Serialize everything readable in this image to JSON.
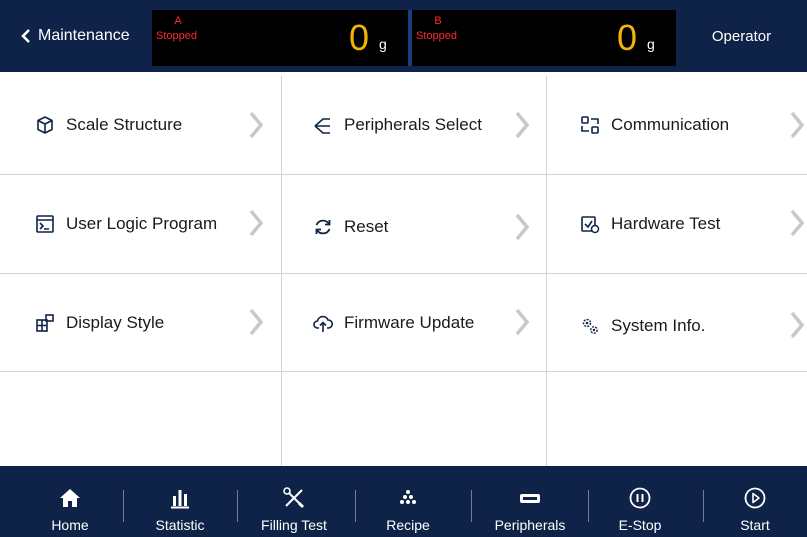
{
  "header": {
    "back_label": "Maintenance",
    "scale_a": {
      "letter": "A",
      "status": "Stopped",
      "value": "0",
      "unit": "g"
    },
    "scale_b": {
      "letter": "B",
      "status": "Stopped",
      "value": "0",
      "unit": "g"
    },
    "user_label": "Operator"
  },
  "menu": {
    "items": [
      {
        "label": "Scale Structure",
        "icon": "cube-icon"
      },
      {
        "label": "Peripherals Select",
        "icon": "branch-icon"
      },
      {
        "label": "Communication",
        "icon": "network-icon"
      },
      {
        "label": "User Logic Program",
        "icon": "terminal-icon"
      },
      {
        "label": "Reset",
        "icon": "refresh-icon"
      },
      {
        "label": "Hardware Test",
        "icon": "hardware-check-icon"
      },
      {
        "label": "Display Style",
        "icon": "layout-icon"
      },
      {
        "label": "Firmware Update",
        "icon": "cloud-upload-icon"
      },
      {
        "label": "System Info.",
        "icon": "gears-icon"
      }
    ]
  },
  "bottom_nav": {
    "items": [
      {
        "label": "Home",
        "icon": "home-icon"
      },
      {
        "label": "Statistic",
        "icon": "bar-chart-icon"
      },
      {
        "label": "Filling Test",
        "icon": "tools-icon"
      },
      {
        "label": "Recipe",
        "icon": "dots-pyramid-icon"
      },
      {
        "label": "Peripherals",
        "icon": "device-icon"
      },
      {
        "label": "E-Stop",
        "icon": "pause-circle-icon"
      },
      {
        "label": "Start",
        "icon": "play-circle-icon"
      }
    ]
  },
  "colors": {
    "header_bg": "#0e2347",
    "scale_panel_bg": "#000000",
    "status_red": "#ff2b2b",
    "weight_amber": "#f5b400",
    "grid_line": "#d4d4d4",
    "arrow_gray": "#c8c8c8"
  }
}
